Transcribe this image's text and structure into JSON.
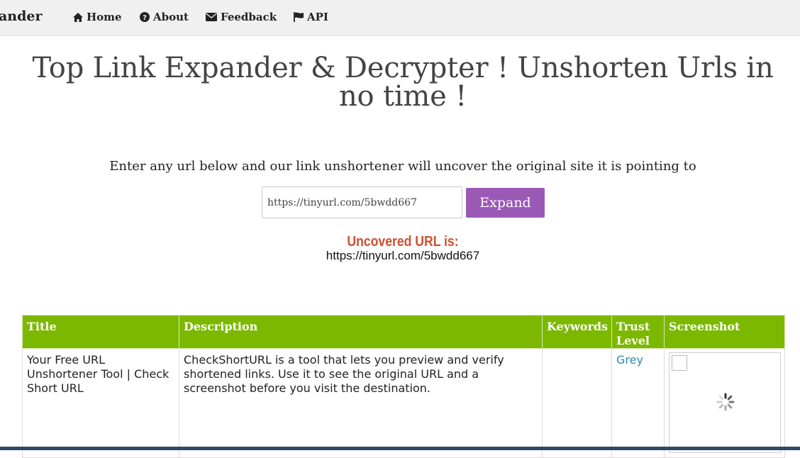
{
  "navbar": {
    "brand": "ander",
    "items": [
      {
        "label": "Home",
        "icon": "home-icon"
      },
      {
        "label": "About",
        "icon": "question-circle-icon"
      },
      {
        "label": "Feedback",
        "icon": "envelope-icon"
      },
      {
        "label": "API",
        "icon": "flag-icon"
      }
    ]
  },
  "hero": {
    "title": "Top Link Expander & Decrypter ! Unshorten Urls in no time !",
    "intro": "Enter any url below and our link unshortener will uncover the original site it is pointing to"
  },
  "form": {
    "url_value": "https://tinyurl.com/5bwdd667",
    "expand_label": "Expand"
  },
  "result": {
    "label": "Uncovered URL is:",
    "url": "https://tinyurl.com/5bwdd667"
  },
  "table": {
    "headers": {
      "title": "Title",
      "description": "Description",
      "keywords": "Keywords",
      "trust": "Trust Level",
      "screenshot": "Screenshot"
    },
    "row": {
      "title": "Your Free URL Unshortener Tool | Check Short URL",
      "description": "CheckShortURL is a tool that lets you preview and verify shortened links. Use it to see the original URL and a screenshot before you visit the destination.",
      "keywords": "",
      "trust": "Grey"
    }
  },
  "colors": {
    "accent_button": "#9b59b6",
    "table_header": "#7cb800",
    "uncovered_label": "#d14f30",
    "trust_link": "#2a8bb5"
  }
}
